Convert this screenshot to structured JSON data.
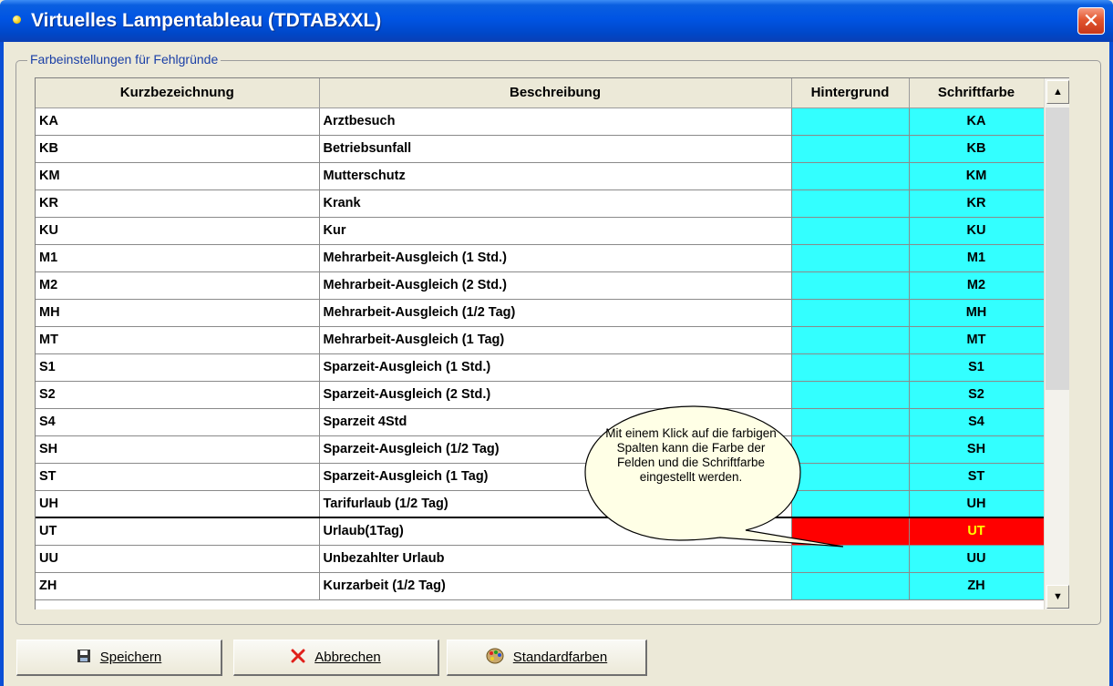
{
  "window": {
    "title": "Virtuelles Lampentableau (TDTABXXL)",
    "close_glyph": "✕"
  },
  "group": {
    "label": "Farbeinstellungen für Fehlgründe"
  },
  "columns": [
    "Kurzbezeichnung",
    "Beschreibung",
    "Hintergrund",
    "Schriftfarbe"
  ],
  "colors": {
    "default_bg": "#33ffff",
    "selected_bg": "#ff0000",
    "selected_fg": "#ffff00"
  },
  "rows": [
    {
      "code": "KA",
      "desc": "Arztbesuch",
      "selected": false
    },
    {
      "code": "KB",
      "desc": "Betriebsunfall",
      "selected": false
    },
    {
      "code": "KM",
      "desc": "Mutterschutz",
      "selected": false
    },
    {
      "code": "KR",
      "desc": "Krank",
      "selected": false
    },
    {
      "code": "KU",
      "desc": "Kur",
      "selected": false
    },
    {
      "code": "M1",
      "desc": "Mehrarbeit-Ausgleich (1 Std.)",
      "selected": false
    },
    {
      "code": "M2",
      "desc": "Mehrarbeit-Ausgleich (2 Std.)",
      "selected": false
    },
    {
      "code": "MH",
      "desc": "Mehrarbeit-Ausgleich (1/2 Tag)",
      "selected": false
    },
    {
      "code": "MT",
      "desc": "Mehrarbeit-Ausgleich (1 Tag)",
      "selected": false
    },
    {
      "code": "S1",
      "desc": "Sparzeit-Ausgleich (1 Std.)",
      "selected": false
    },
    {
      "code": "S2",
      "desc": "Sparzeit-Ausgleich (2 Std.)",
      "selected": false
    },
    {
      "code": "S4",
      "desc": "Sparzeit 4Std",
      "selected": false
    },
    {
      "code": "SH",
      "desc": "Sparzeit-Ausgleich (1/2 Tag)",
      "selected": false
    },
    {
      "code": "ST",
      "desc": "Sparzeit-Ausgleich (1 Tag)",
      "selected": false
    },
    {
      "code": "UH",
      "desc": "Tarifurlaub (1/2 Tag)",
      "selected": false
    },
    {
      "code": "UT",
      "desc": "Urlaub(1Tag)",
      "selected": true
    },
    {
      "code": "UU",
      "desc": "Unbezahlter Urlaub",
      "selected": false
    },
    {
      "code": "ZH",
      "desc": "Kurzarbeit (1/2 Tag)",
      "selected": false
    }
  ],
  "tooltip": {
    "text": "Mit einem Klick auf die farbigen Spalten kann die Farbe der Felden und die Schriftfarbe eingestellt werden."
  },
  "buttons": {
    "save": "Speichern",
    "cancel": "Abbrechen",
    "defaults": "Standardfarben"
  },
  "icons": {
    "save": "floppy-disk-icon",
    "cancel": "red-x-icon",
    "defaults": "palette-icon",
    "title": "app-dot-icon"
  }
}
